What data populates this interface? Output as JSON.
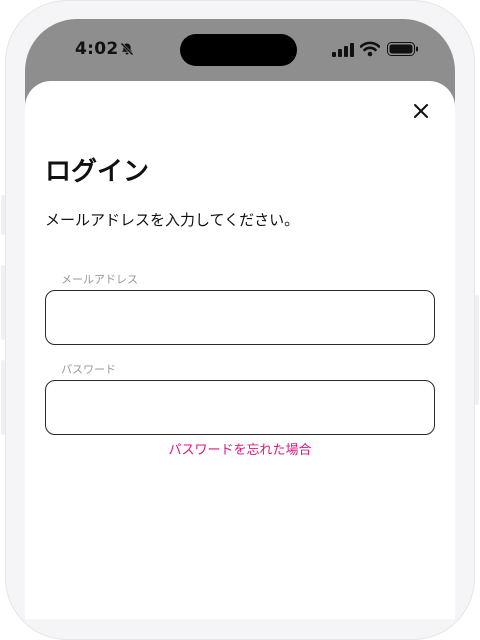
{
  "status_bar": {
    "time": "4:02",
    "icons": [
      "bell-slash-icon",
      "signal-icon",
      "wifi-icon",
      "battery-icon"
    ]
  },
  "sheet": {
    "title": "ログイン",
    "subtitle": "メールアドレスを入力してください。",
    "close_icon": "close-icon",
    "email": {
      "label": "メールアドレス",
      "value": "",
      "placeholder": ""
    },
    "password": {
      "label": "パスワード",
      "value": "",
      "placeholder": ""
    },
    "forgot_password_link": "パスワードを忘れた場合"
  },
  "colors": {
    "accent": "#e0167d",
    "backdrop": "#8e8e8e",
    "text": "#111111",
    "label": "#9a9a9a"
  }
}
